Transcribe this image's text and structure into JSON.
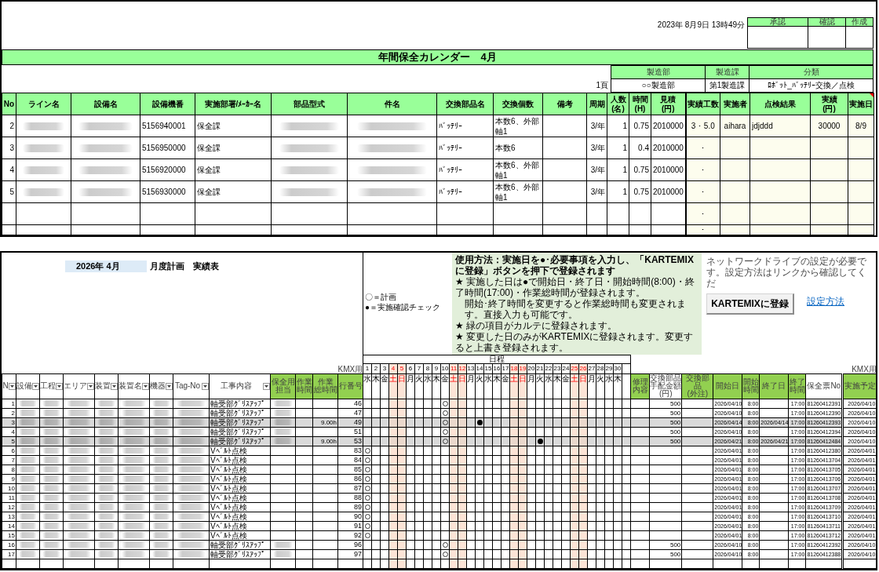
{
  "report": {
    "timestamp": "2023年 8月9日 13時49分",
    "approvals": [
      {
        "label": "承認"
      },
      {
        "label": "確認"
      },
      {
        "label": "作成"
      }
    ],
    "title": "年間保全カレンダー　4月",
    "page": "1頁",
    "info": [
      {
        "label": "製造部",
        "value": "○○製造部"
      },
      {
        "label": "製造課",
        "value": "第1製造課"
      },
      {
        "label": "分類",
        "value": "ﾛﾎﾞｯﾄ_ﾊﾞｯﾃﾘｰ交換／点検"
      }
    ],
    "table": {
      "columns": [
        {
          "lines": [
            "No"
          ],
          "kind": "data",
          "comment": false
        },
        {
          "lines": [
            "ライン名"
          ],
          "kind": "data",
          "comment": false
        },
        {
          "lines": [
            "設備名"
          ],
          "kind": "data",
          "comment": false
        },
        {
          "lines": [
            "設備機番"
          ],
          "kind": "data",
          "comment": false
        },
        {
          "lines": [
            "実施部署/ﾒｰｶｰ名"
          ],
          "kind": "data",
          "comment": false
        },
        {
          "lines": [
            "部品型式"
          ],
          "kind": "data",
          "comment": false
        },
        {
          "lines": [
            "件名"
          ],
          "kind": "data",
          "comment": false
        },
        {
          "lines": [
            "交換部品名"
          ],
          "kind": "data",
          "comment": false
        },
        {
          "lines": [
            "交換個数"
          ],
          "kind": "data",
          "comment": false
        },
        {
          "lines": [
            "備考"
          ],
          "kind": "data",
          "comment": false
        },
        {
          "lines": [
            "周期"
          ],
          "kind": "data",
          "comment": false
        },
        {
          "lines": [
            "人数",
            "(名)"
          ],
          "kind": "data",
          "comment": false
        },
        {
          "lines": [
            "時間",
            "(H)"
          ],
          "kind": "data",
          "comment": false
        },
        {
          "lines": [
            "見積",
            "(円)"
          ],
          "kind": "data",
          "comment": false
        },
        {
          "lines": [
            "実績工数"
          ],
          "kind": "entry",
          "comment": false
        },
        {
          "lines": [
            "実施者"
          ],
          "kind": "entry",
          "comment": false
        },
        {
          "lines": [
            "点検結果"
          ],
          "kind": "entry",
          "comment": false
        },
        {
          "lines": [
            "実績",
            "(円)"
          ],
          "kind": "entry",
          "comment": false
        },
        {
          "lines": [
            "実施日"
          ],
          "kind": "entry",
          "comment": true
        }
      ],
      "rows": [
        {
          "redacted": true,
          "no": "2",
          "machine_no": "5156940001",
          "dept": "保全課",
          "part_name": "ﾊﾞｯﾃﾘｰ",
          "quantity": "本数6、外部軸1",
          "cycle": "3/年",
          "people": "1",
          "hours": "0.75",
          "estimate": "2010000",
          "actual_hours": "3 ･ 5.0",
          "worker": "aihara",
          "result": "jdjddd",
          "actual_cost": "30000",
          "date": "8/9"
        },
        {
          "redacted": true,
          "no": "3",
          "machine_no": "5156950000",
          "dept": "保全課",
          "part_name": "ﾊﾞｯﾃﾘｰ",
          "quantity": "本数6",
          "cycle": "3/年",
          "people": "1",
          "hours": "0.4",
          "estimate": "2010000",
          "actual_hours": "･"
        },
        {
          "redacted": true,
          "no": "4",
          "machine_no": "5156920000",
          "dept": "保全課",
          "part_name": "ﾊﾞｯﾃﾘｰ",
          "quantity": "本数6、外部軸1",
          "cycle": "3/年",
          "people": "1",
          "hours": "0.75",
          "estimate": "2010000",
          "actual_hours": "･"
        },
        {
          "redacted": true,
          "no": "5",
          "machine_no": "5156930000",
          "dept": "保全課",
          "part_name": "ﾊﾞｯﾃﾘｰ",
          "quantity": "本数6、外部軸1",
          "cycle": "3/年",
          "people": "1",
          "hours": "0.75",
          "estimate": "2010000",
          "actual_hours": "･"
        },
        {
          "redacted": false,
          "actual_hours": "･"
        },
        {
          "redacted": false,
          "actual_hours": "･"
        }
      ]
    }
  },
  "plan": {
    "month": "2026年 4月",
    "title": "月度計画　実績表",
    "legend": [
      {
        "text": "〇＝計画"
      },
      {
        "text": "●＝実施確認チェック"
      }
    ],
    "instructions": {
      "heading": "使用方法：実施日を●･必要事項を入力し、「KARTEMIXに登録」ボタンを押下で登録されます",
      "lines": [
        {
          "kind": "bullet",
          "text": "★ 実施した日は●で開始日・終了日・開始時間(8:00)・終了時間(17:00)・作業総時間が登録されます。"
        },
        {
          "kind": "continuation",
          "text": "開始･終了時間を変更すると作業総時間も変更されます。直接入力も可能です。"
        },
        {
          "kind": "bullet",
          "text": "★ 緑の項目がカルテに登録されます。"
        },
        {
          "kind": "bullet",
          "text": "★ 変更した日のみがKARTEMIXに登録されます。変更すると上書き登録されます。"
        }
      ]
    },
    "note": "ネットワークドライブの設定が必要です。設定方法はリンクから確認してくだ",
    "register_button": "KARTEMIXに登録",
    "link": "設定方法",
    "schedule_label": "日程",
    "columns_left": [
      {
        "lines": [
          "N"
        ],
        "filter": true,
        "shaded": false
      },
      {
        "lines": [
          "設備"
        ],
        "filter": true,
        "shaded": false
      },
      {
        "lines": [
          "工程"
        ],
        "filter": true,
        "shaded": false
      },
      {
        "lines": [
          "エリア"
        ],
        "filter": true,
        "shaded": false
      },
      {
        "lines": [
          "装置"
        ],
        "filter": true,
        "shaded": false
      },
      {
        "lines": [
          "装置名"
        ],
        "filter": true,
        "shaded": false
      },
      {
        "lines": [
          "機器"
        ],
        "filter": true,
        "shaded": false
      },
      {
        "lines": [
          "Tag-No"
        ],
        "filter": true,
        "shaded": false
      },
      {
        "lines": [
          "工事内容"
        ],
        "filter": true,
        "shaded": false
      },
      {
        "lines": [
          "保全用",
          "担当"
        ],
        "filter": false,
        "shaded": true
      },
      {
        "lines": [
          "作業",
          "時間"
        ],
        "filter": false,
        "shaded": true
      },
      {
        "lines": [
          "作業",
          "総時間"
        ],
        "filter": false,
        "shaded": true
      },
      {
        "lines": [
          "行番号"
        ],
        "filter": false,
        "shaded": true,
        "note": "KMX用"
      }
    ],
    "days": [
      {
        "number": "1",
        "weekday": "水",
        "weekend": false
      },
      {
        "number": "2",
        "weekday": "木",
        "weekend": false
      },
      {
        "number": "3",
        "weekday": "金",
        "weekend": false
      },
      {
        "number": "4",
        "weekday": "土",
        "weekend": true
      },
      {
        "number": "5",
        "weekday": "日",
        "weekend": true
      },
      {
        "number": "6",
        "weekday": "月",
        "weekend": false
      },
      {
        "number": "7",
        "weekday": "火",
        "weekend": false
      },
      {
        "number": "8",
        "weekday": "水",
        "weekend": false
      },
      {
        "number": "9",
        "weekday": "木",
        "weekend": false
      },
      {
        "number": "10",
        "weekday": "金",
        "weekend": false
      },
      {
        "number": "11",
        "weekday": "土",
        "weekend": true
      },
      {
        "number": "12",
        "weekday": "日",
        "weekend": true
      },
      {
        "number": "13",
        "weekday": "月",
        "weekend": false
      },
      {
        "number": "14",
        "weekday": "火",
        "weekend": false
      },
      {
        "number": "15",
        "weekday": "水",
        "weekend": false
      },
      {
        "number": "16",
        "weekday": "木",
        "weekend": false
      },
      {
        "number": "17",
        "weekday": "金",
        "weekend": false
      },
      {
        "number": "18",
        "weekday": "土",
        "weekend": true
      },
      {
        "number": "19",
        "weekday": "日",
        "weekend": true
      },
      {
        "number": "20",
        "weekday": "月",
        "weekend": false
      },
      {
        "number": "21",
        "weekday": "火",
        "weekend": false
      },
      {
        "number": "22",
        "weekday": "水",
        "weekend": false
      },
      {
        "number": "23",
        "weekday": "木",
        "weekend": false
      },
      {
        "number": "24",
        "weekday": "金",
        "weekend": false
      },
      {
        "number": "25",
        "weekday": "土",
        "weekend": true
      },
      {
        "number": "26",
        "weekday": "日",
        "weekend": true
      },
      {
        "number": "27",
        "weekday": "月",
        "weekend": false
      },
      {
        "number": "28",
        "weekday": "火",
        "weekend": false
      },
      {
        "number": "29",
        "weekday": "水",
        "weekend": false
      },
      {
        "number": "30",
        "weekday": "木",
        "weekend": false
      }
    ],
    "columns_right": [
      {
        "lines": [
          "修理",
          "内容"
        ],
        "filter": false,
        "shaded": true
      },
      {
        "lines": [
          "交換部品",
          "手配金額",
          "(円)"
        ],
        "filter": false,
        "shaded": false
      },
      {
        "lines": [
          "交換部品",
          "(外注)"
        ],
        "filter": false,
        "shaded": true
      },
      {
        "lines": [
          "開始日"
        ],
        "filter": false,
        "shaded": true
      },
      {
        "lines": [
          "開始",
          "時間"
        ],
        "filter": false,
        "shaded": true
      },
      {
        "lines": [
          "終了日"
        ],
        "filter": false,
        "shaded": true
      },
      {
        "lines": [
          "終了",
          "時間"
        ],
        "filter": false,
        "shaded": true
      },
      {
        "lines": [
          "保全票No"
        ],
        "filter": false,
        "shaded": false
      },
      {
        "lines": [
          "実施予定"
        ],
        "filter": false,
        "shaded": true,
        "note": "KMX用"
      }
    ],
    "rows": [
      {
        "highlighted": false,
        "redacted": true,
        "staff_redacted": true,
        "no": "1",
        "work": "軸受部ｸﾞﾘｽｱｯﾌﾟ",
        "row_no": "46",
        "planned": [
          false,
          false,
          false,
          false,
          false,
          false,
          false,
          false,
          false,
          true,
          false,
          false,
          false,
          false,
          false,
          false,
          false,
          false,
          false,
          false,
          false,
          false,
          false,
          false,
          false,
          false,
          false,
          false,
          false,
          false
        ],
        "done": [
          false,
          false,
          false,
          false,
          false,
          false,
          false,
          false,
          false,
          false,
          false,
          false,
          false,
          false,
          false,
          false,
          false,
          false,
          false,
          false,
          false,
          false,
          false,
          false,
          false,
          false,
          false,
          false,
          false,
          false
        ],
        "parts_cost": "500",
        "start_date": "2026/04/10",
        "start_time": "8:00",
        "end_time": "17:00",
        "slip_no": "81260412391",
        "scheduled": "2026/04/10"
      },
      {
        "highlighted": false,
        "redacted": true,
        "staff_redacted": true,
        "no": "2",
        "work": "軸受部ｸﾞﾘｽｱｯﾌﾟ",
        "row_no": "47",
        "planned": [
          false,
          false,
          false,
          false,
          false,
          false,
          false,
          false,
          false,
          true,
          false,
          false,
          false,
          false,
          false,
          false,
          false,
          false,
          false,
          false,
          false,
          false,
          false,
          false,
          false,
          false,
          false,
          false,
          false,
          false
        ],
        "done": [
          false,
          false,
          false,
          false,
          false,
          false,
          false,
          false,
          false,
          false,
          false,
          false,
          false,
          false,
          false,
          false,
          false,
          false,
          false,
          false,
          false,
          false,
          false,
          false,
          false,
          false,
          false,
          false,
          false,
          false
        ],
        "parts_cost": "500",
        "start_date": "2026/04/10",
        "start_time": "8:00",
        "end_time": "17:00",
        "slip_no": "81260412390",
        "scheduled": "2026/04/10"
      },
      {
        "highlighted": true,
        "redacted": true,
        "staff_redacted": true,
        "no": "3",
        "work": "軸受部ｸﾞﾘｽｱｯﾌﾟ",
        "total_hours": "9.00h",
        "row_no": "49",
        "planned": [
          false,
          false,
          false,
          false,
          false,
          false,
          false,
          false,
          false,
          true,
          false,
          false,
          false,
          false,
          false,
          false,
          false,
          false,
          false,
          false,
          false,
          false,
          false,
          false,
          false,
          false,
          false,
          false,
          false,
          false
        ],
        "done": [
          false,
          false,
          false,
          false,
          false,
          false,
          false,
          false,
          false,
          false,
          false,
          false,
          false,
          true,
          false,
          false,
          false,
          false,
          false,
          false,
          false,
          false,
          false,
          false,
          false,
          false,
          false,
          false,
          false,
          false
        ],
        "parts_cost": "500",
        "start_date": "2026/04/14",
        "start_time": "8:00",
        "end_date": "2026/04/14",
        "end_time": "17:00",
        "slip_no": "81260412393",
        "scheduled": "2026/04/10"
      },
      {
        "highlighted": false,
        "redacted": true,
        "staff_redacted": true,
        "no": "4",
        "work": "軸受部ｸﾞﾘｽｱｯﾌﾟ",
        "row_no": "51",
        "planned": [
          false,
          false,
          false,
          false,
          false,
          false,
          false,
          false,
          false,
          true,
          false,
          false,
          false,
          false,
          false,
          false,
          false,
          false,
          false,
          false,
          false,
          false,
          false,
          false,
          false,
          false,
          false,
          false,
          false,
          false
        ],
        "done": [
          false,
          false,
          false,
          false,
          false,
          false,
          false,
          false,
          false,
          false,
          false,
          false,
          false,
          false,
          false,
          false,
          false,
          false,
          false,
          false,
          false,
          false,
          false,
          false,
          false,
          false,
          false,
          false,
          false,
          false
        ],
        "parts_cost": "500",
        "start_date": "2026/04/10",
        "start_time": "8:00",
        "end_time": "17:00",
        "slip_no": "81260412394",
        "scheduled": "2026/04/10"
      },
      {
        "highlighted": true,
        "redacted": true,
        "staff_redacted": true,
        "no": "5",
        "work": "軸受部ｸﾞﾘｽｱｯﾌﾟ",
        "total_hours": "9.00h",
        "row_no": "53",
        "planned": [
          false,
          false,
          false,
          false,
          false,
          false,
          false,
          false,
          false,
          true,
          false,
          false,
          false,
          false,
          false,
          false,
          false,
          false,
          false,
          false,
          false,
          false,
          false,
          false,
          false,
          false,
          false,
          false,
          false,
          false
        ],
        "done": [
          false,
          false,
          false,
          false,
          false,
          false,
          false,
          false,
          false,
          false,
          false,
          false,
          false,
          false,
          false,
          false,
          false,
          false,
          false,
          false,
          true,
          false,
          false,
          false,
          false,
          false,
          false,
          false,
          false,
          false
        ],
        "parts_cost": "500",
        "start_date": "2026/04/21",
        "start_time": "8:00",
        "end_date": "2026/04/21",
        "end_time": "17:00",
        "slip_no": "81260412484",
        "scheduled": "2026/04/10"
      },
      {
        "highlighted": false,
        "redacted": true,
        "staff_redacted": false,
        "no": "6",
        "work": "Vﾍﾞﾙﾄ点検",
        "row_no": "83",
        "planned": [
          true,
          false,
          false,
          false,
          false,
          false,
          false,
          false,
          false,
          false,
          false,
          false,
          false,
          false,
          false,
          false,
          false,
          false,
          false,
          false,
          false,
          false,
          false,
          false,
          false,
          false,
          false,
          false,
          false,
          false
        ],
        "done": [
          false,
          false,
          false,
          false,
          false,
          false,
          false,
          false,
          false,
          false,
          false,
          false,
          false,
          false,
          false,
          false,
          false,
          false,
          false,
          false,
          false,
          false,
          false,
          false,
          false,
          false,
          false,
          false,
          false,
          false
        ],
        "start_date": "2026/04/01",
        "start_time": "8:00",
        "end_time": "17:00",
        "slip_no": "81260412380",
        "scheduled": "2026/04/01"
      },
      {
        "highlighted": false,
        "redacted": true,
        "staff_redacted": false,
        "no": "7",
        "work": "Vﾍﾞﾙﾄ点検",
        "row_no": "84",
        "planned": [
          true,
          false,
          false,
          false,
          false,
          false,
          false,
          false,
          false,
          false,
          false,
          false,
          false,
          false,
          false,
          false,
          false,
          false,
          false,
          false,
          false,
          false,
          false,
          false,
          false,
          false,
          false,
          false,
          false,
          false
        ],
        "done": [
          false,
          false,
          false,
          false,
          false,
          false,
          false,
          false,
          false,
          false,
          false,
          false,
          false,
          false,
          false,
          false,
          false,
          false,
          false,
          false,
          false,
          false,
          false,
          false,
          false,
          false,
          false,
          false,
          false,
          false
        ],
        "start_date": "2026/04/01",
        "start_time": "8:00",
        "end_time": "17:00",
        "slip_no": "81260413704",
        "scheduled": "2026/04/01"
      },
      {
        "highlighted": false,
        "redacted": true,
        "staff_redacted": false,
        "no": "8",
        "work": "Vﾍﾞﾙﾄ点検",
        "row_no": "85",
        "planned": [
          true,
          false,
          false,
          false,
          false,
          false,
          false,
          false,
          false,
          false,
          false,
          false,
          false,
          false,
          false,
          false,
          false,
          false,
          false,
          false,
          false,
          false,
          false,
          false,
          false,
          false,
          false,
          false,
          false,
          false
        ],
        "done": [
          false,
          false,
          false,
          false,
          false,
          false,
          false,
          false,
          false,
          false,
          false,
          false,
          false,
          false,
          false,
          false,
          false,
          false,
          false,
          false,
          false,
          false,
          false,
          false,
          false,
          false,
          false,
          false,
          false,
          false
        ],
        "start_date": "2026/04/01",
        "start_time": "8:00",
        "end_time": "17:00",
        "slip_no": "81260413705",
        "scheduled": "2026/04/01"
      },
      {
        "highlighted": false,
        "redacted": true,
        "staff_redacted": false,
        "no": "9",
        "work": "Vﾍﾞﾙﾄ点検",
        "row_no": "86",
        "planned": [
          true,
          false,
          false,
          false,
          false,
          false,
          false,
          false,
          false,
          false,
          false,
          false,
          false,
          false,
          false,
          false,
          false,
          false,
          false,
          false,
          false,
          false,
          false,
          false,
          false,
          false,
          false,
          false,
          false,
          false
        ],
        "done": [
          false,
          false,
          false,
          false,
          false,
          false,
          false,
          false,
          false,
          false,
          false,
          false,
          false,
          false,
          false,
          false,
          false,
          false,
          false,
          false,
          false,
          false,
          false,
          false,
          false,
          false,
          false,
          false,
          false,
          false
        ],
        "start_date": "2026/04/01",
        "start_time": "8:00",
        "end_time": "17:00",
        "slip_no": "81260413706",
        "scheduled": "2026/04/01"
      },
      {
        "highlighted": false,
        "redacted": true,
        "staff_redacted": false,
        "no": "10",
        "work": "Vﾍﾞﾙﾄ点検",
        "row_no": "87",
        "planned": [
          true,
          false,
          false,
          false,
          false,
          false,
          false,
          false,
          false,
          false,
          false,
          false,
          false,
          false,
          false,
          false,
          false,
          false,
          false,
          false,
          false,
          false,
          false,
          false,
          false,
          false,
          false,
          false,
          false,
          false
        ],
        "done": [
          false,
          false,
          false,
          false,
          false,
          false,
          false,
          false,
          false,
          false,
          false,
          false,
          false,
          false,
          false,
          false,
          false,
          false,
          false,
          false,
          false,
          false,
          false,
          false,
          false,
          false,
          false,
          false,
          false,
          false
        ],
        "start_date": "2026/04/01",
        "start_time": "8:00",
        "end_time": "17:00",
        "slip_no": "81260413707",
        "scheduled": "2026/04/01"
      },
      {
        "highlighted": false,
        "redacted": true,
        "staff_redacted": false,
        "no": "11",
        "work": "Vﾍﾞﾙﾄ点検",
        "row_no": "88",
        "planned": [
          true,
          false,
          false,
          false,
          false,
          false,
          false,
          false,
          false,
          false,
          false,
          false,
          false,
          false,
          false,
          false,
          false,
          false,
          false,
          false,
          false,
          false,
          false,
          false,
          false,
          false,
          false,
          false,
          false,
          false
        ],
        "done": [
          false,
          false,
          false,
          false,
          false,
          false,
          false,
          false,
          false,
          false,
          false,
          false,
          false,
          false,
          false,
          false,
          false,
          false,
          false,
          false,
          false,
          false,
          false,
          false,
          false,
          false,
          false,
          false,
          false,
          false
        ],
        "start_date": "2026/04/01",
        "start_time": "8:00",
        "end_time": "17:00",
        "slip_no": "81260413708",
        "scheduled": "2026/04/01"
      },
      {
        "highlighted": false,
        "redacted": true,
        "staff_redacted": false,
        "no": "12",
        "work": "Vﾍﾞﾙﾄ点検",
        "row_no": "89",
        "planned": [
          true,
          false,
          false,
          false,
          false,
          false,
          false,
          false,
          false,
          false,
          false,
          false,
          false,
          false,
          false,
          false,
          false,
          false,
          false,
          false,
          false,
          false,
          false,
          false,
          false,
          false,
          false,
          false,
          false,
          false
        ],
        "done": [
          false,
          false,
          false,
          false,
          false,
          false,
          false,
          false,
          false,
          false,
          false,
          false,
          false,
          false,
          false,
          false,
          false,
          false,
          false,
          false,
          false,
          false,
          false,
          false,
          false,
          false,
          false,
          false,
          false,
          false
        ],
        "start_date": "2026/04/01",
        "start_time": "8:00",
        "end_time": "17:00",
        "slip_no": "81260413709",
        "scheduled": "2026/04/01"
      },
      {
        "highlighted": false,
        "redacted": true,
        "staff_redacted": false,
        "no": "13",
        "work": "Vﾍﾞﾙﾄ点検",
        "row_no": "90",
        "planned": [
          true,
          false,
          false,
          false,
          false,
          false,
          false,
          false,
          false,
          false,
          false,
          false,
          false,
          false,
          false,
          false,
          false,
          false,
          false,
          false,
          false,
          false,
          false,
          false,
          false,
          false,
          false,
          false,
          false,
          false
        ],
        "done": [
          false,
          false,
          false,
          false,
          false,
          false,
          false,
          false,
          false,
          false,
          false,
          false,
          false,
          false,
          false,
          false,
          false,
          false,
          false,
          false,
          false,
          false,
          false,
          false,
          false,
          false,
          false,
          false,
          false,
          false
        ],
        "start_date": "2026/04/01",
        "start_time": "8:00",
        "end_time": "17:00",
        "slip_no": "81260413710",
        "scheduled": "2026/04/01"
      },
      {
        "highlighted": false,
        "redacted": true,
        "staff_redacted": false,
        "no": "14",
        "work": "Vﾍﾞﾙﾄ点検",
        "row_no": "91",
        "planned": [
          true,
          false,
          false,
          false,
          false,
          false,
          false,
          false,
          false,
          false,
          false,
          false,
          false,
          false,
          false,
          false,
          false,
          false,
          false,
          false,
          false,
          false,
          false,
          false,
          false,
          false,
          false,
          false,
          false,
          false
        ],
        "done": [
          false,
          false,
          false,
          false,
          false,
          false,
          false,
          false,
          false,
          false,
          false,
          false,
          false,
          false,
          false,
          false,
          false,
          false,
          false,
          false,
          false,
          false,
          false,
          false,
          false,
          false,
          false,
          false,
          false,
          false
        ],
        "start_date": "2026/04/01",
        "start_time": "8:00",
        "end_time": "17:00",
        "slip_no": "81260413711",
        "scheduled": "2026/04/01"
      },
      {
        "highlighted": false,
        "redacted": true,
        "staff_redacted": false,
        "no": "15",
        "work": "Vﾍﾞﾙﾄ点検",
        "row_no": "92",
        "planned": [
          true,
          false,
          false,
          false,
          false,
          false,
          false,
          false,
          false,
          false,
          false,
          false,
          false,
          false,
          false,
          false,
          false,
          false,
          false,
          false,
          false,
          false,
          false,
          false,
          false,
          false,
          false,
          false,
          false,
          false
        ],
        "done": [
          false,
          false,
          false,
          false,
          false,
          false,
          false,
          false,
          false,
          false,
          false,
          false,
          false,
          false,
          false,
          false,
          false,
          false,
          false,
          false,
          false,
          false,
          false,
          false,
          false,
          false,
          false,
          false,
          false,
          false
        ],
        "start_date": "2026/04/01",
        "start_time": "8:00",
        "end_time": "17:00",
        "slip_no": "81260413712",
        "scheduled": "2026/04/01"
      },
      {
        "highlighted": false,
        "redacted": true,
        "staff_redacted": true,
        "no": "16",
        "work": "軸受部ｸﾞﾘｽｱｯﾌﾟ",
        "row_no": "96",
        "planned": [
          false,
          false,
          false,
          false,
          false,
          false,
          false,
          false,
          false,
          true,
          false,
          false,
          false,
          false,
          false,
          false,
          false,
          false,
          false,
          false,
          false,
          false,
          false,
          false,
          false,
          false,
          false,
          false,
          false,
          false
        ],
        "done": [
          false,
          false,
          false,
          false,
          false,
          false,
          false,
          false,
          false,
          false,
          false,
          false,
          false,
          false,
          false,
          false,
          false,
          false,
          false,
          false,
          false,
          false,
          false,
          false,
          false,
          false,
          false,
          false,
          false,
          false
        ],
        "parts_cost": "500",
        "start_date": "2026/04/10",
        "start_time": "8:00",
        "end_time": "17:00",
        "slip_no": "81260412392",
        "scheduled": "2026/04/10"
      },
      {
        "highlighted": false,
        "redacted": true,
        "staff_redacted": true,
        "no": "17",
        "work": "軸受部ｸﾞﾘｽｱｯﾌﾟ",
        "row_no": "97",
        "planned": [
          false,
          false,
          false,
          false,
          false,
          false,
          false,
          false,
          false,
          true,
          false,
          false,
          false,
          false,
          false,
          false,
          false,
          false,
          false,
          false,
          false,
          false,
          false,
          false,
          false,
          false,
          false,
          false,
          false,
          false
        ],
        "done": [
          false,
          false,
          false,
          false,
          false,
          false,
          false,
          false,
          false,
          false,
          false,
          false,
          false,
          false,
          false,
          false,
          false,
          false,
          false,
          false,
          false,
          false,
          false,
          false,
          false,
          false,
          false,
          false,
          false,
          false
        ],
        "parts_cost": "500",
        "start_date": "2026/04/10",
        "start_time": "8:00",
        "end_time": "17:00",
        "slip_no": "81260412388",
        "scheduled": "2026/04/10"
      }
    ]
  }
}
